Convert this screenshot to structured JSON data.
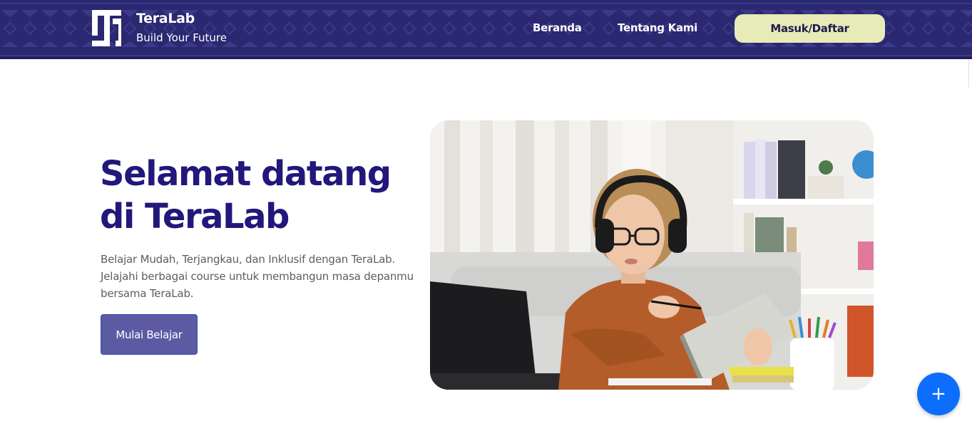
{
  "navbar": {
    "brand_name": "TeraLab",
    "tagline": "Build Your Future",
    "logo_icon": "teralab-logo-icon",
    "links": [
      {
        "label": "Beranda"
      },
      {
        "label": "Tentang Kami"
      }
    ],
    "login_label": "Masuk/Daftar"
  },
  "hero": {
    "title": "Selamat datang di TeraLab",
    "description": "Belajar Mudah, Terjangkau, dan Inklusif dengan TeraLab. Jelajahi berbagai course untuk membangun masa depanmu bersama TeraLab.",
    "cta_label": "Mulai Belajar",
    "image_subject": "woman-studying-with-headphones-and-laptop"
  },
  "fab": {
    "symbol": "+",
    "icon": "plus-icon"
  },
  "colors": {
    "navbar_bg": "#2a2870",
    "login_button_bg": "#e7ebb7",
    "title_color": "#22177a",
    "cta_bg": "#5d5aa4",
    "fab_bg": "#0d6efd"
  }
}
